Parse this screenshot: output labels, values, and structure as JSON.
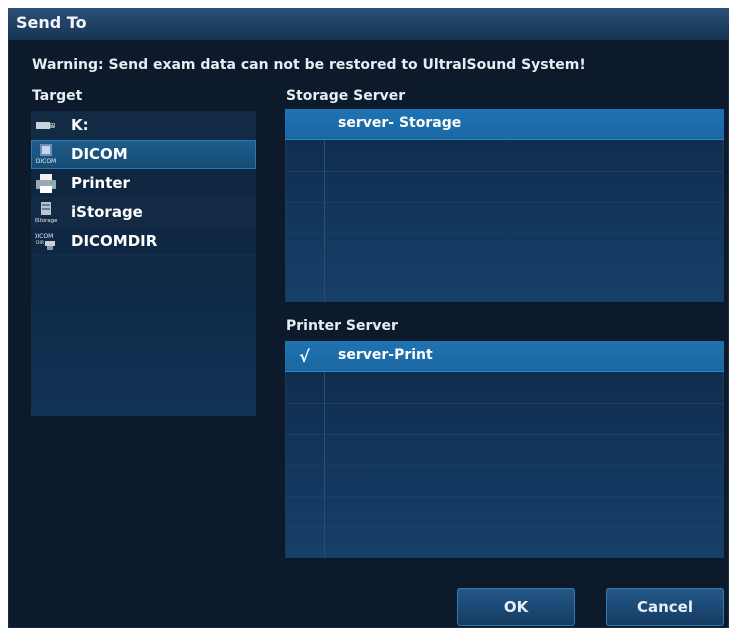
{
  "dialog": {
    "title": "Send To",
    "warning": "Warning: Send exam data can not be restored to UltralSound System!"
  },
  "target": {
    "label": "Target",
    "items": [
      {
        "label": "K:",
        "icon": "usb-drive-icon"
      },
      {
        "label": "DICOM",
        "icon": "dicom-icon",
        "selected": true
      },
      {
        "label": "Printer",
        "icon": "printer-icon"
      },
      {
        "label": "iStorage",
        "icon": "istorage-icon"
      },
      {
        "label": "DICOMDIR",
        "icon": "dicomdir-icon"
      }
    ]
  },
  "storage_server": {
    "label": "Storage Server",
    "rows": [
      {
        "check": "",
        "name": "server- Storage"
      }
    ]
  },
  "printer_server": {
    "label": "Printer Server",
    "rows": [
      {
        "check": "√",
        "name": "server-Print"
      }
    ]
  },
  "buttons": {
    "ok": "OK",
    "cancel": "Cancel"
  }
}
